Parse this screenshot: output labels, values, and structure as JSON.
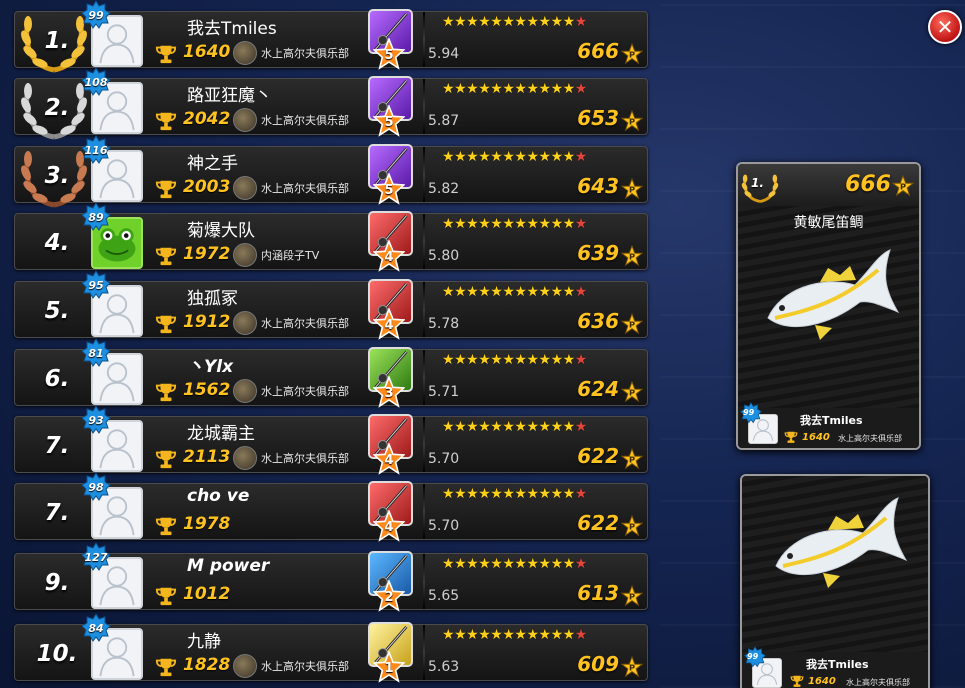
{
  "close_label": "✕",
  "leaderboard": [
    {
      "rank": "1.",
      "level": "99",
      "name": "我去Tmiles",
      "latin": false,
      "score": "1640",
      "club": "水上高尔夫俱乐部",
      "rod_level": "5",
      "rod_color": "purple",
      "stars": "12",
      "weight": "5.94",
      "points": "666",
      "medal": "gold",
      "avatar": "default"
    },
    {
      "rank": "2.",
      "level": "108",
      "name": "路亚狂魔丶",
      "latin": false,
      "score": "2042",
      "club": "水上高尔夫俱乐部",
      "rod_level": "5",
      "rod_color": "purple",
      "stars": "11",
      "weight": "5.87",
      "points": "653",
      "medal": "silver",
      "avatar": "default"
    },
    {
      "rank": "3.",
      "level": "116",
      "name": "神之手",
      "latin": false,
      "score": "2003",
      "club": "水上高尔夫俱乐部",
      "rod_level": "5",
      "rod_color": "purple",
      "stars": "11",
      "weight": "5.82",
      "points": "643",
      "medal": "bronze",
      "avatar": "default"
    },
    {
      "rank": "4.",
      "level": "89",
      "name": "菊爆大队",
      "latin": false,
      "score": "1972",
      "club": "内涵段子TV",
      "rod_level": "4",
      "rod_color": "red",
      "stars": "11",
      "weight": "5.80",
      "points": "639",
      "medal": "none",
      "avatar": "frog"
    },
    {
      "rank": "5.",
      "level": "95",
      "name": "独孤冢",
      "latin": false,
      "score": "1912",
      "club": "水上高尔夫俱乐部",
      "rod_level": "4",
      "rod_color": "red",
      "stars": "11",
      "weight": "5.78",
      "points": "636",
      "medal": "none",
      "avatar": "default"
    },
    {
      "rank": "6.",
      "level": "81",
      "name": "丶Ylx",
      "latin": true,
      "score": "1562",
      "club": "水上高尔夫俱乐部",
      "rod_level": "3",
      "rod_color": "green",
      "stars": "11",
      "weight": "5.71",
      "points": "624",
      "medal": "none",
      "avatar": "default"
    },
    {
      "rank": "7.",
      "level": "93",
      "name": "龙城霸主",
      "latin": false,
      "score": "2113",
      "club": "水上高尔夫俱乐部",
      "rod_level": "4",
      "rod_color": "red",
      "stars": "11",
      "weight": "5.70",
      "points": "622",
      "medal": "none",
      "avatar": "default"
    },
    {
      "rank": "7.",
      "level": "98",
      "name": "cho ve",
      "latin": true,
      "score": "1978",
      "club": "",
      "rod_level": "4",
      "rod_color": "red",
      "stars": "11",
      "weight": "5.70",
      "points": "622",
      "medal": "none",
      "avatar": "default"
    },
    {
      "rank": "9.",
      "level": "127",
      "name": "M  power",
      "latin": true,
      "score": "1012",
      "club": "",
      "rod_level": "2",
      "rod_color": "blue",
      "stars": "11",
      "weight": "5.65",
      "points": "613",
      "medal": "none",
      "avatar": "default"
    },
    {
      "rank": "10.",
      "level": "84",
      "name": "九静",
      "latin": false,
      "score": "1828",
      "club": "水上高尔夫俱乐部",
      "rod_level": "1",
      "rod_color": "yellow",
      "stars": "11",
      "weight": "5.63",
      "points": "609",
      "medal": "none",
      "avatar": "default"
    }
  ],
  "detail_card": {
    "rank": "1.",
    "points": "666",
    "fish_name": "黄敏尾笛鲷",
    "level": "99",
    "player": "我去Tmiles",
    "score": "1640",
    "club": "水上高尔夫俱乐部"
  },
  "second_card": {
    "level": "99",
    "player": "我去Tmiles",
    "score": "1640",
    "club": "水上高尔夫俱乐部"
  },
  "colors": {
    "gold": "#ffc21f",
    "row_bg": "#1c1c1c",
    "badge": "#1d8fe0",
    "close": "#d11a1a"
  }
}
